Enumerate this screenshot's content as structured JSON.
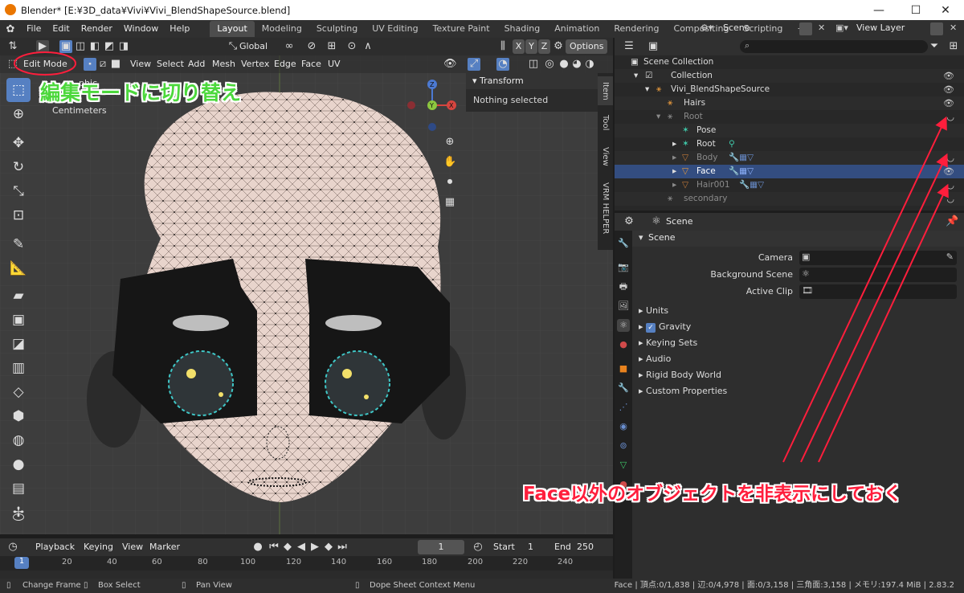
{
  "window": {
    "title": "Blender* [E:¥3D_data¥Vivi¥Vivi_BlendShapeSource.blend]",
    "controls": [
      "—",
      "☐",
      "✕"
    ]
  },
  "menu": [
    "File",
    "Edit",
    "Render",
    "Window",
    "Help"
  ],
  "workspaces": [
    "Layout",
    "Modeling",
    "Sculpting",
    "UV Editing",
    "Texture Paint",
    "Shading",
    "Animation",
    "Rendering",
    "Compositing",
    "Scripting"
  ],
  "active_workspace": "Layout",
  "scene_selector": {
    "label": "Scene",
    "view_layer": "View Layer"
  },
  "viewport": {
    "header": {
      "transform_orientation": "Global",
      "axes": [
        "X",
        "Y",
        "Z"
      ],
      "options_label": "Options"
    },
    "mode_header": {
      "mode": "Edit Mode",
      "menus": [
        "View",
        "Select",
        "Add",
        "Mesh",
        "Vertex",
        "Edge",
        "Face",
        "UV"
      ]
    },
    "overlay_text": {
      "projection_partial": "phic",
      "units": "Centimeters"
    },
    "gizmo_axes": [
      "X",
      "Y",
      "Z"
    ],
    "n_panel": {
      "title": "Transform",
      "body": "Nothing selected",
      "tabs": [
        "Item",
        "Tool",
        "View",
        "VRM HELPER"
      ]
    }
  },
  "timeline": {
    "menus": [
      "Playback",
      "Keying",
      "View",
      "Marker"
    ],
    "current_frame": "1",
    "start_label": "Start",
    "start_value": "1",
    "end_label": "End",
    "end_value": "250",
    "ticks": [
      "1",
      "20",
      "40",
      "60",
      "80",
      "100",
      "120",
      "140",
      "160",
      "180",
      "200",
      "220",
      "240"
    ]
  },
  "outliner": {
    "rows": [
      {
        "label": "Scene Collection",
        "indent": 0,
        "state": "normal",
        "eye": false
      },
      {
        "label": "Collection",
        "indent": 1,
        "state": "normal",
        "eye": true
      },
      {
        "label": "Vivi_BlendShapeSource",
        "indent": 2,
        "state": "normal",
        "eye": true
      },
      {
        "label": "Hairs",
        "indent": 3,
        "state": "normal",
        "eye": true
      },
      {
        "label": "Root",
        "indent": 3,
        "state": "dim",
        "eye": false
      },
      {
        "label": "Pose",
        "indent": 4,
        "state": "normal",
        "eye": false
      },
      {
        "label": "Root",
        "indent": 4,
        "state": "normal",
        "eye": false
      },
      {
        "label": "Body",
        "indent": 4,
        "state": "dim",
        "eye": false
      },
      {
        "label": "Face",
        "indent": 4,
        "state": "selected",
        "eye": true
      },
      {
        "label": "Hair001",
        "indent": 4,
        "state": "dim",
        "eye": false
      },
      {
        "label": "secondary",
        "indent": 3,
        "state": "dim",
        "eye": false
      }
    ]
  },
  "properties": {
    "header_title": "Scene",
    "panel_title": "Scene",
    "fields": [
      {
        "label": "Camera"
      },
      {
        "label": "Background Scene"
      },
      {
        "label": "Active Clip"
      }
    ],
    "subpanels": [
      "Units",
      "Gravity",
      "Keying Sets",
      "Audio",
      "Rigid Body World",
      "Custom Properties"
    ]
  },
  "statusbar": {
    "left": [
      "Change Frame",
      "Box Select",
      "Pan View",
      "Dope Sheet Context Menu"
    ],
    "right": "Face | 頂点:0/1,838 | 辺:0/4,978 | 面:0/3,158 | 三角面:3,158 | メモリ:197.4 MiB | 2.83.2"
  },
  "annotations": {
    "edit_mode_note": "編集モードに切り替え",
    "hide_note": "Face以外のオブジェクトを非表示にしておく"
  },
  "colors": {
    "selected_row": "#334d80",
    "active_tool": "#5680c2",
    "annotation_green": "#4cd83c",
    "annotation_red": "#ff1e3c",
    "mesh_skin": "#e8d4cc"
  }
}
